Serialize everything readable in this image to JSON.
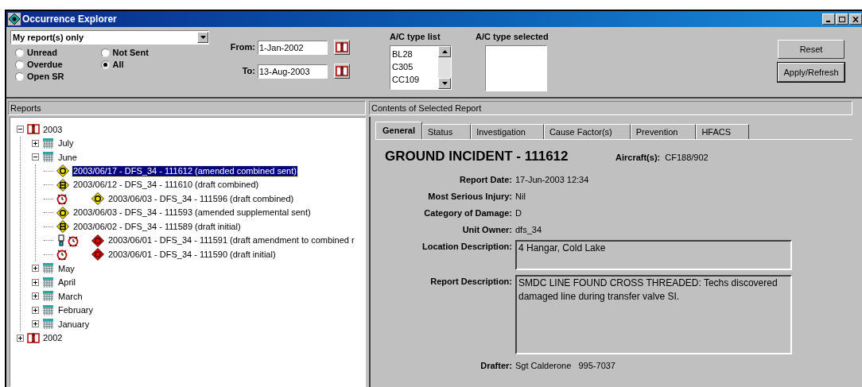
{
  "window": {
    "title": "Occurrence Explorer"
  },
  "filter": {
    "scope": "My report(s) only",
    "options": [
      {
        "label": "Unread",
        "selected": false
      },
      {
        "label": "Overdue",
        "selected": false
      },
      {
        "label": "Open SR",
        "selected": false
      },
      {
        "label": "Not Sent",
        "selected": false
      },
      {
        "label": "All",
        "selected": true
      }
    ],
    "from_label": "From:",
    "from": "1-Jan-2002",
    "to_label": "To:",
    "to": "13-Aug-2003"
  },
  "ac_type_list": {
    "label": "A/C type list",
    "items": [
      "BL28",
      "C305",
      "CC109"
    ]
  },
  "ac_type_selected": {
    "label": "A/C type selected"
  },
  "buttons": [
    {
      "label": "Reset"
    },
    {
      "label": "Apply/Refresh"
    }
  ],
  "reports_panel": {
    "title": "Reports",
    "tree": [
      {
        "kind": "year",
        "label": "2003",
        "expanded": true,
        "children": [
          {
            "kind": "month",
            "label": "July",
            "expanded": false
          },
          {
            "kind": "month",
            "label": "June",
            "expanded": true,
            "children": [
              {
                "kind": "report",
                "label": "2003/06/17 - DFS_34 - 111612 (amended combined sent)",
                "selected": true,
                "icons": [
                  {
                    "kind": "yellowcircle"
                  }
                ]
              },
              {
                "kind": "report",
                "label": "2003/06/12 - DFS_34 - 111610 (draft combined)",
                "selected": false,
                "icons": [
                  {
                    "kind": "yellowb"
                  }
                ]
              },
              {
                "kind": "report",
                "label": "2003/06/03 - DFS_34 - 111596 (draft combined)",
                "selected": false,
                "icons": [
                  {
                    "kind": "alarm"
                  },
                  {
                    "kind": "yellowcircle"
                  }
                ]
              },
              {
                "kind": "report",
                "label": "2003/06/03 - DFS_34 - 111593 (amended supplemental sent)",
                "selected": false,
                "icons": [
                  {
                    "kind": "yellowcircle"
                  }
                ]
              },
              {
                "kind": "report",
                "label": "2003/06/02 - DFS_34 - 111589 (draft initial)",
                "selected": false,
                "icons": [
                  {
                    "kind": "yellowb"
                  }
                ]
              },
              {
                "kind": "report",
                "label": "2003/06/01 - DFS_34 - 111591 (draft amendment to combined r",
                "selected": false,
                "icons": [
                  {
                    "kind": "lamp"
                  },
                  {
                    "kind": "alarm"
                  },
                  {
                    "kind": "red"
                  }
                ]
              },
              {
                "kind": "report",
                "label": "2003/06/01 - DFS_34 - 111590 (draft initial)",
                "selected": false,
                "icons": [
                  {
                    "kind": "alarm"
                  },
                  {
                    "kind": "red"
                  }
                ]
              }
            ]
          },
          {
            "kind": "month",
            "label": "May",
            "expanded": false
          },
          {
            "kind": "month",
            "label": "April",
            "expanded": false
          },
          {
            "kind": "month",
            "label": "March",
            "expanded": false
          },
          {
            "kind": "month",
            "label": "February",
            "expanded": false
          },
          {
            "kind": "month",
            "label": "January",
            "expanded": false
          }
        ]
      },
      {
        "kind": "year",
        "label": "2002",
        "expanded": false
      }
    ]
  },
  "contents_panel": {
    "title": "Contents of Selected Report",
    "tabs": [
      {
        "label": "General",
        "selected": true
      },
      {
        "label": "Status",
        "selected": false
      },
      {
        "label": "Investigation",
        "selected": false
      },
      {
        "label": "Cause Factor(s)",
        "selected": false
      },
      {
        "label": "Prevention",
        "selected": false
      },
      {
        "label": "HFACS",
        "selected": false
      }
    ],
    "heading": "GROUND INCIDENT - 111612",
    "aircraft_label": "Aircraft(s):",
    "aircraft": "CF188/902",
    "fields": [
      {
        "kind": "text",
        "label": "Report Date:",
        "value": "17-Jun-2003 12:34"
      },
      {
        "kind": "text",
        "label": "Most Serious Injury:",
        "value": "Nil"
      },
      {
        "kind": "text",
        "label": "Category of Damage:",
        "value": "D"
      },
      {
        "kind": "text",
        "label": "Unit Owner:",
        "value": "dfs_34"
      },
      {
        "kind": "box",
        "label": "Location Description:",
        "value": "4 Hangar, Cold Lake"
      },
      {
        "kind": "tallbox",
        "label": "Report Description:",
        "value": "SMDC LINE FOUND CROSS THREADED:  Techs discovered damaged line during transfer valve SI."
      },
      {
        "kind": "text",
        "label": "Drafter:",
        "value": "Sgt Calderone   995-7037"
      }
    ]
  }
}
